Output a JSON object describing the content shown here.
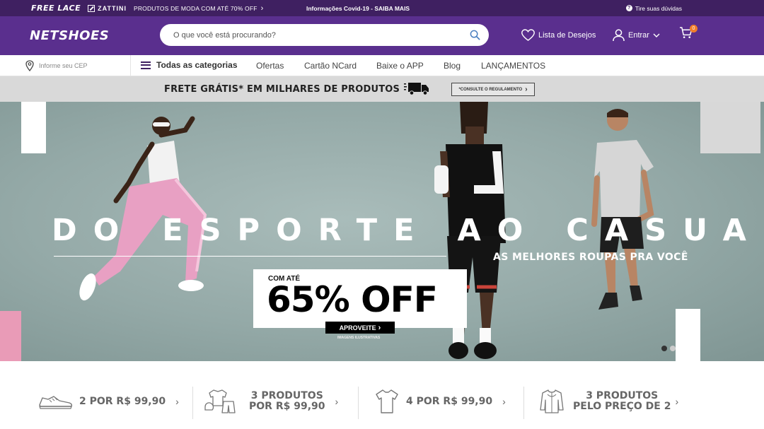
{
  "topbar": {
    "freelace": "FREE LACE",
    "zattini": "ZATTINI",
    "promo": "PRODUTOS DE MODA COM ATÉ 70% OFF",
    "promo_chevron": "›",
    "covid": "Informações Covid-19 - SAIBA MAIS",
    "help": "Tire suas dúvidas",
    "help_icon": "question-circle-icon"
  },
  "header": {
    "logo": "NETSHOES",
    "search_placeholder": "O que você está procurando?",
    "wishlist": "Lista de Desejos",
    "login": "Entrar",
    "cart_count": "0"
  },
  "nav": {
    "cep_placeholder": "Informe seu CEP",
    "all_categories": "Todas as categorias",
    "links": [
      "Ofertas",
      "Cartão NCard",
      "Baixe o APP",
      "Blog",
      "LANÇAMENTOS"
    ]
  },
  "shipping": {
    "text": "FRETE GRÁTIS* EM MILHARES DE PRODUTOS",
    "button": "*CONSULTE O REGULAMENTO",
    "button_chevron": "›"
  },
  "hero": {
    "title": "DO ESPORTE AO CASUAL",
    "subtitle": "AS MELHORES ROUPAS PRA VOCÊ",
    "upto": "COM ATÉ",
    "discount": "65% OFF",
    "cta": "APROVEITE",
    "cta_chevron": "›",
    "disclaimer": "IMAGENS ILUSTRATIVAS",
    "active_slide": 1,
    "slide_count": 2
  },
  "promos": [
    {
      "line1": "2 POR R$ 99,90",
      "line2": "",
      "icon": "sneaker-icon"
    },
    {
      "line1": "3 PRODUTOS",
      "line2": "POR R$ 99,90",
      "icon": "clothes-set-icon"
    },
    {
      "line1": "4 POR R$ 99,90",
      "line2": "",
      "icon": "tshirt-icon"
    },
    {
      "line1": "3 PRODUTOS",
      "line2": "PELO PREÇO DE 2",
      "icon": "jacket-icon"
    }
  ],
  "promo_chevron": "›",
  "colors": {
    "topbar": "#3f2061",
    "header": "#5a2f8e",
    "cart_badge": "#f17d2a"
  }
}
